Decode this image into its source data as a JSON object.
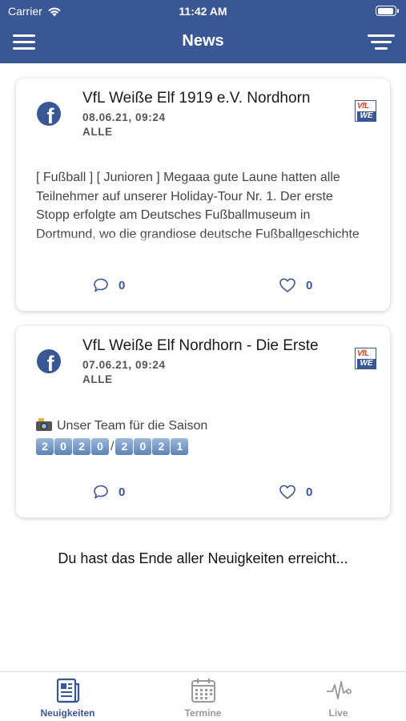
{
  "status_bar": {
    "carrier": "Carrier",
    "time": "11:42 AM"
  },
  "header": {
    "title": "News"
  },
  "posts": [
    {
      "title": "VfL Weiße Elf 1919 e.V. Nordhorn",
      "date": "08.06.21, 09:24",
      "audience": "ALLE",
      "body": "[ Fußball ] [ Junioren ] Megaaa gute Laune hatten alle Teilnehmer auf unserer Holiday-Tour Nr. 1. Der erste Stopp erfolgte am Deutsches Fußballmuseum in Dortmund, wo die grandiose deutsche Fußballgeschichte auf uns Junioren wartete.",
      "comments": "0",
      "likes": "0",
      "logo_text_top": "VfL",
      "logo_text_bottom": "WE"
    },
    {
      "title": "VfL Weiße Elf Nordhorn - Die Erste",
      "date": "07.06.21, 09:24",
      "audience": "ALLE",
      "body": "Unser Team für die Saison",
      "season_digits_a": [
        "2",
        "0",
        "2",
        "0"
      ],
      "season_separator": "/",
      "season_digits_b": [
        "2",
        "0",
        "2",
        "1"
      ],
      "comments": "0",
      "likes": "0",
      "logo_text_top": "VfL",
      "logo_text_bottom": "WE"
    }
  ],
  "end_message": "Du hast das Ende aller Neuigkeiten erreicht...",
  "tabs": [
    {
      "label": "Neuigkeiten",
      "icon": "newspaper-icon",
      "active": true
    },
    {
      "label": "Termine",
      "icon": "calendar-icon",
      "active": false
    },
    {
      "label": "Live",
      "icon": "heartbeat-icon",
      "active": false
    }
  ],
  "colors": {
    "primary": "#3a5795",
    "inactive": "#999999",
    "accent_logo": "#d8462a"
  }
}
